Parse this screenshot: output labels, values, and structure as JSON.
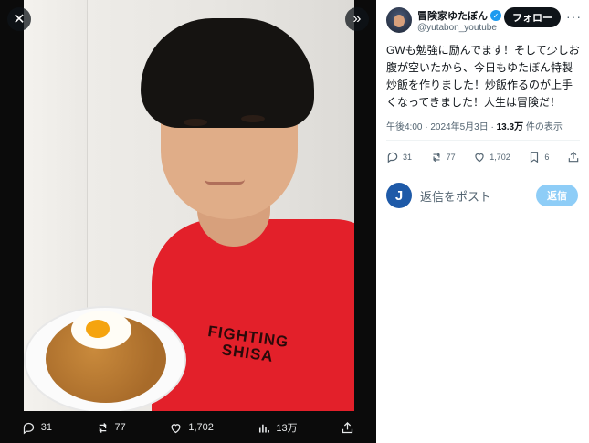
{
  "media": {
    "close_icon": "close-icon",
    "expand_icon": "chevron-double-right-icon",
    "shirt_print": [
      "FIGHTING",
      "SHISA"
    ],
    "bar": {
      "replies": "31",
      "reposts": "77",
      "likes": "1,702",
      "views": "13万"
    }
  },
  "panel": {
    "display_name": "冒険家ゆたぼん",
    "handle": "@yutabon_youtube",
    "follow_label": "フォロー",
    "more_label": "···",
    "tweet_text": "GWも勉強に励んでます！そして少しお腹が空いたから、今日もゆたぼん特製炒飯を作りました！炒飯作るのが上手くなってきました！人生は冒険だ！",
    "time": "午後4:00 · 2024年5月3日 · ",
    "views_count": "13.3万",
    "views_suffix": " 件の表示",
    "actions": {
      "replies": "31",
      "reposts": "77",
      "likes": "1,702",
      "bookmarks": "6"
    },
    "reply": {
      "avatar_letter": "J",
      "placeholder": "返信をポスト",
      "button_label": "返信"
    }
  },
  "colors": {
    "accent": "#1d9bf0",
    "reply_button": "#8ecdf7",
    "text": "#0f1419",
    "muted": "#536471"
  }
}
